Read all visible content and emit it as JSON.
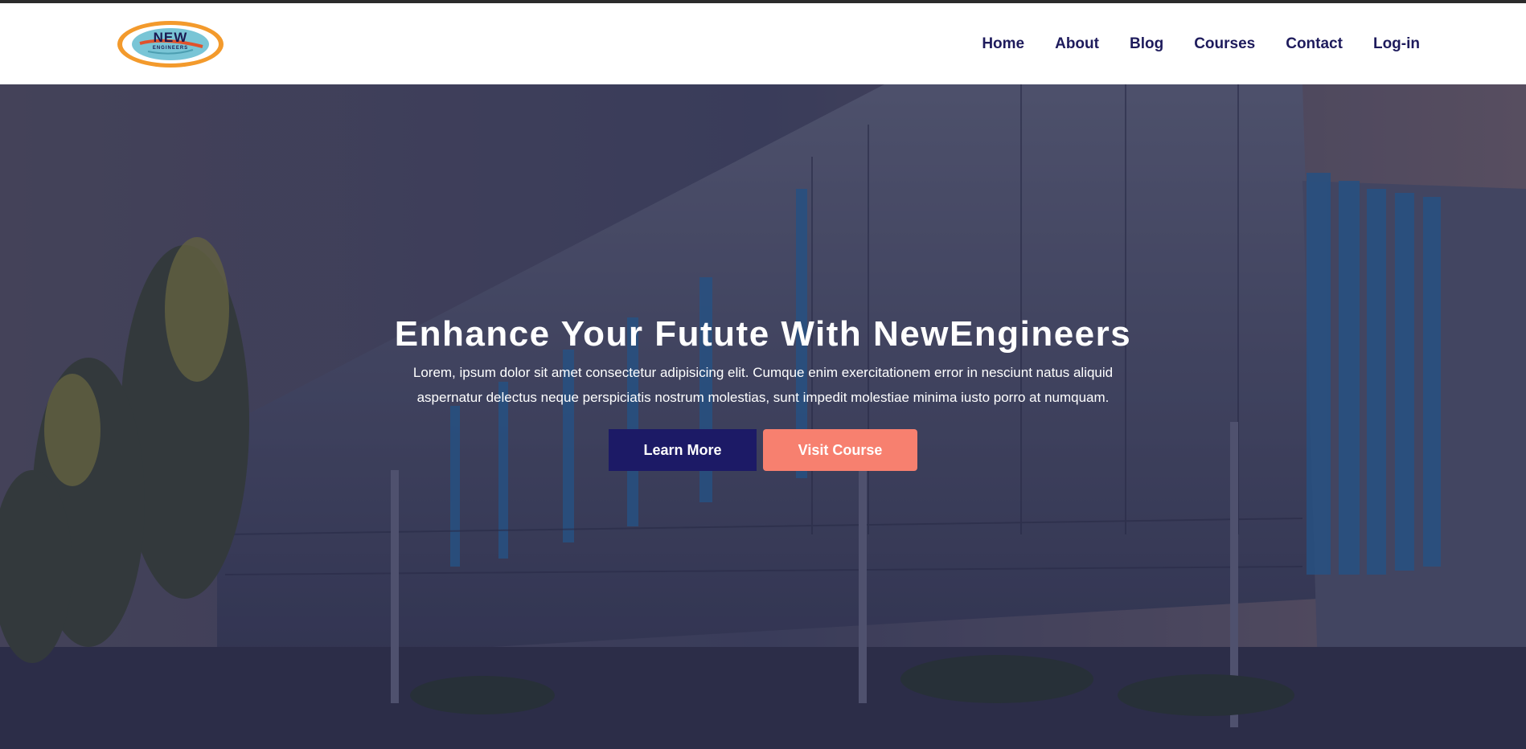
{
  "brand": {
    "logo_main": "NEW",
    "logo_sub": "ENGINEERS",
    "colors": {
      "ring": "#f39a2c",
      "globe": "#79c5d6",
      "text": "#1b1a52"
    }
  },
  "nav": {
    "items": [
      {
        "label": "Home"
      },
      {
        "label": "About"
      },
      {
        "label": "Blog"
      },
      {
        "label": "Courses"
      },
      {
        "label": "Contact"
      },
      {
        "label": "Log-in"
      }
    ],
    "color": "#1e1b5c"
  },
  "hero": {
    "title": "Enhance Your Futute With NewEngineers",
    "description": "Lorem, ipsum dolor sit amet consectetur adipisicing elit. Cumque enim exercitationem error in nesciunt natus aliquid aspernatur delectus neque perspiciatis nostrum molestias, sunt impedit molestiae minima iusto porro at numquam.",
    "primary_button": "Learn More",
    "secondary_button": "Visit Course",
    "colors": {
      "primary": "#1c1a66",
      "secondary": "#f7806f"
    }
  }
}
